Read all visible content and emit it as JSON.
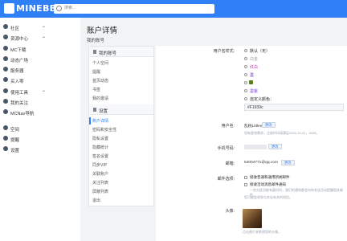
{
  "header": {
    "brand": "MINEBBS",
    "search_placeholder": "搜索..."
  },
  "sidebar": {
    "items": [
      {
        "label": "社区",
        "chevron": "⌄"
      },
      {
        "label": "资源中心",
        "chevron": "⌄"
      },
      {
        "label": "MC下载",
        "chevron": ""
      },
      {
        "label": "动态广场",
        "chevron": ""
      },
      {
        "label": "服务器",
        "chevron": ""
      },
      {
        "label": "买入零",
        "chevron": ""
      },
      {
        "label": "使用工具",
        "chevron": "⌄"
      },
      {
        "label": "我的关注",
        "chevron": ""
      },
      {
        "label": "MCNav导航",
        "chevron": ""
      },
      {
        "label": "空间",
        "chevron": ""
      },
      {
        "label": "提醒",
        "chevron": ""
      },
      {
        "label": "设置",
        "chevron": ""
      }
    ]
  },
  "page": {
    "title": "账户详情",
    "breadcrumb": "我的账号"
  },
  "menu": {
    "section1": "我的账号",
    "section1_items": [
      "个人空间",
      "提醒",
      "首页动态",
      "书签",
      "我的邀请"
    ],
    "section2": "设置",
    "section2_items": [
      "账户详情",
      "密码和安全性",
      "隐私设置",
      "隐藏统计",
      "签名设置",
      "同步VIP",
      "关联账户",
      "关注列表",
      "屏蔽列表",
      "退出"
    ]
  },
  "form": {
    "username_style_label": "用户名样式:",
    "style_options": [
      "默认（无）",
      "白金",
      "红白",
      "墨",
      "",
      "墨紫",
      "自定义颜色："
    ],
    "color_value": "#F1939c",
    "username_label": "用户名:",
    "username_value": "乱桃Littlemt",
    "username_button": "更改",
    "username_hint": "如有更改需求，注册时间请满足2024-10-01，2025。",
    "phone_label": "手机号码:",
    "phone_button": "更改",
    "email_label": "邮箱:",
    "email_value": "54004771@qq.com",
    "email_button": "更改",
    "email_options_label": "邮件选项:",
    "email_opt1": "接收普通和通用新闻邮件",
    "email_opt2": "接收活动消息邮件通知",
    "email_opt2_hint": "一些对此功能有疑问时，我们的通知都会向你发送活动提醒相关邮件。",
    "email_hint2": "您可能会收到与本站有关的短信。",
    "avatar_label": "头像:",
    "avatar_hint": "点击图片来更改您的头像。"
  },
  "colors": {
    "accent": "#2f7ff6",
    "swatches": [
      "#9aa3ad",
      "#e0b21f",
      "#c03aa8",
      "#6a2fbf",
      "#5b7d1d",
      "#7b3ff0",
      "#f1939c"
    ]
  }
}
